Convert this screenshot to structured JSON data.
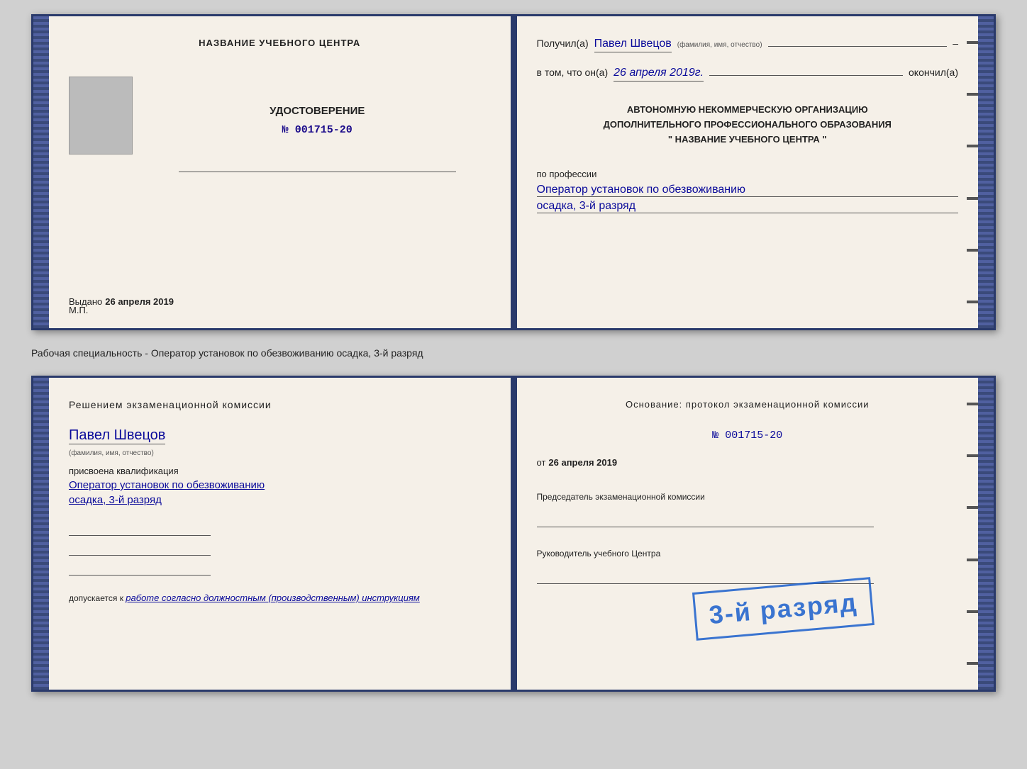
{
  "doc1": {
    "left": {
      "center_title": "НАЗВАНИЕ УЧЕБНОГО ЦЕНТРА",
      "cert_label": "УДОСТОВЕРЕНИЕ",
      "cert_number": "№ 001715-20",
      "issued_prefix": "Выдано",
      "issued_date": "26 апреля 2019",
      "mp_label": "М.П."
    },
    "right": {
      "received_prefix": "Получил(а)",
      "recipient_name": "Павел Швецов",
      "recipient_note": "(фамилия, имя, отчество)",
      "in_that_prefix": "в том, что он(а)",
      "date_handwritten": "26 апреля 2019г.",
      "finished_label": "окончил(а)",
      "org_line1": "АВТОНОМНУЮ НЕКОММЕРЧЕСКУЮ ОРГАНИЗАЦИЮ",
      "org_line2": "ДОПОЛНИТЕЛЬНОГО ПРОФЕССИОНАЛЬНОГО ОБРАЗОВАНИЯ",
      "org_line3": "\"   НАЗВАНИЕ УЧЕБНОГО ЦЕНТРА   \"",
      "profession_prefix": "по профессии",
      "profession_value": "Оператор установок по обезвоживанию",
      "rank_value": "осадка, 3-й разряд"
    }
  },
  "between_label": "Рабочая специальность - Оператор установок по обезвоживанию осадка, 3-й разряд",
  "doc2": {
    "left": {
      "decision_title": "Решением экзаменационной комиссии",
      "person_name": "Павел Швецов",
      "person_note": "(фамилия, имя, отчество)",
      "assigned_label": "присвоена квалификация",
      "profession_value": "Оператор установок по обезвоживанию",
      "rank_value": "осадка, 3-й разряд",
      "допускается_prefix": "допускается к",
      "допускается_value": "работе согласно должностным (производственным) инструкциям"
    },
    "right": {
      "osnov_title": "Основание: протокол экзаменационной комиссии",
      "protocol_number": "№  001715-20",
      "ot_prefix": "от",
      "ot_date": "26 апреля 2019",
      "chairman_label": "Председатель экзаменационной комиссии",
      "руковод_label": "Руководитель учебного Центра"
    },
    "stamp": {
      "line1": "",
      "main": "3-й разряд"
    }
  }
}
